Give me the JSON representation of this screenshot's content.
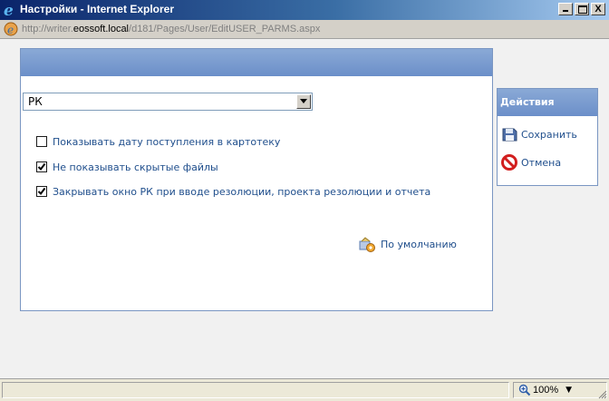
{
  "window": {
    "title": "Настройки - Internet Explorer",
    "close_glyph": "X"
  },
  "address": {
    "scheme": "http://writer.",
    "host": "eossoft.local",
    "path": "/d181/Pages/User/EditUSER_PARMS.aspx"
  },
  "main": {
    "section_select": {
      "value": "РК"
    },
    "options": [
      {
        "label": "Показывать дату поступления в картотеку",
        "checked": false
      },
      {
        "label": "Не показывать скрытые файлы",
        "checked": true
      },
      {
        "label": "Закрывать окно РК при вводе резолюции, проекта резолюции и отчета",
        "checked": true
      }
    ],
    "default_label": "По умолчанию"
  },
  "actions": {
    "title": "Действия",
    "save_label": "Сохранить",
    "cancel_label": "Отмена"
  },
  "status": {
    "zoom": "100%",
    "zoom_arrow": "▼"
  },
  "colors": {
    "header_blue": "#6b8fc9",
    "link_blue": "#1f4e8c"
  }
}
